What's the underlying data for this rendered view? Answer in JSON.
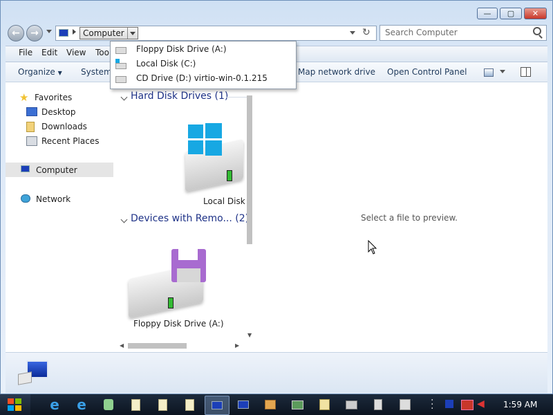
{
  "window": {
    "minimize_glyph": "—",
    "maximize_glyph": "▢",
    "close_glyph": "✕"
  },
  "address": {
    "crumb": "Computer",
    "search_placeholder": "Search Computer"
  },
  "menu": [
    "File",
    "Edit",
    "View",
    "Too"
  ],
  "commands": {
    "organize": "Organize",
    "system": "System",
    "map_drive": "Map network drive",
    "control_panel": "Open Control Panel"
  },
  "nav": {
    "favorites": "Favorites",
    "desktop": "Desktop",
    "downloads": "Downloads",
    "recent": "Recent Places",
    "computer": "Computer",
    "network": "Network"
  },
  "content": {
    "group1": "Hard Disk Drives (1)",
    "group2": "Devices with Remo... (2)",
    "local_disk": "Local Disk (",
    "floppy": "Floppy Disk Drive (A:)"
  },
  "preview": {
    "message": "Select a file to preview."
  },
  "dropdown": [
    "Floppy Disk Drive (A:)",
    "Local Disk (C:)",
    "CD Drive (D:) virtio-win-0.1.215"
  ],
  "taskbar": {
    "clock": "1:59 AM"
  },
  "colors": {
    "accent": "#1e3287",
    "windows_blue": "#17a8e3",
    "floppy_purple": "#a86bd0",
    "close_red": "#c8372a"
  }
}
